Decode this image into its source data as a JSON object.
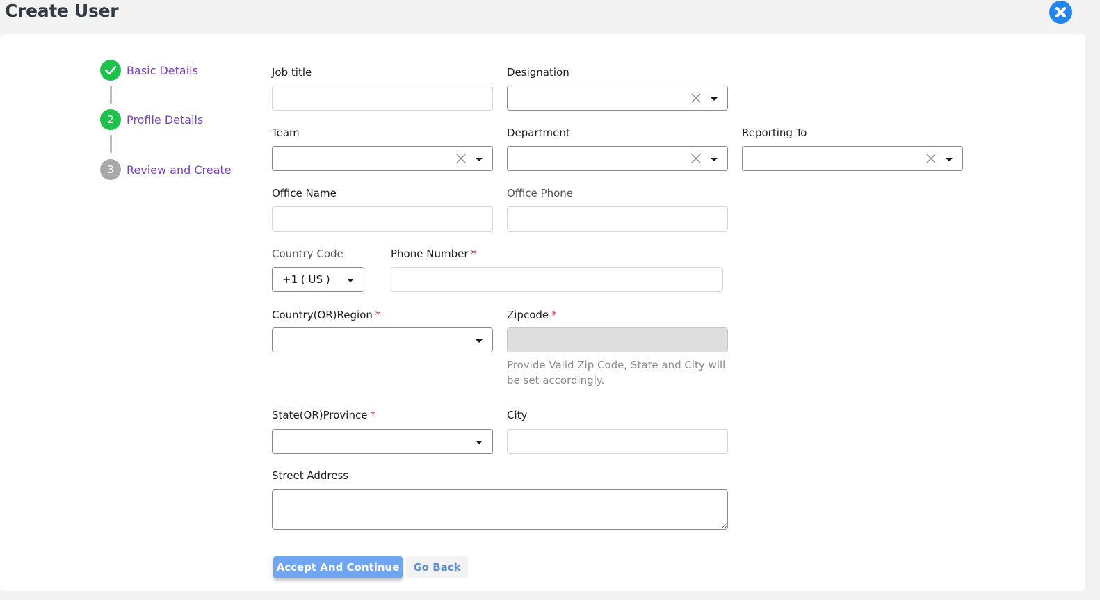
{
  "header": {
    "title": "Create User"
  },
  "stepper": {
    "steps": [
      {
        "label": "Basic Details",
        "marker": "",
        "state": "completed"
      },
      {
        "label": "Profile Details",
        "marker": "2",
        "state": "active"
      },
      {
        "label": "Review and Create",
        "marker": "3",
        "state": "pending"
      }
    ]
  },
  "form": {
    "job_title": {
      "label": "Job title",
      "value": ""
    },
    "designation": {
      "label": "Designation",
      "value": ""
    },
    "team": {
      "label": "Team",
      "value": ""
    },
    "department": {
      "label": "Department",
      "value": ""
    },
    "reporting_to": {
      "label": "Reporting To",
      "value": ""
    },
    "office_name": {
      "label": "Office Name",
      "value": ""
    },
    "office_phone": {
      "label": "Office Phone",
      "value": ""
    },
    "country_code": {
      "label": "Country Code",
      "value": "+1 ( US )"
    },
    "phone_number": {
      "label": "Phone Number",
      "required": "*",
      "value": ""
    },
    "country_region": {
      "label": "Country(OR)Region",
      "required": "*",
      "value": ""
    },
    "zipcode": {
      "label": "Zipcode",
      "required": "*",
      "value": "",
      "helper": "Provide Valid Zip Code, State and City will be set accordingly."
    },
    "state_province": {
      "label": "State(OR)Province",
      "required": "*",
      "value": ""
    },
    "city": {
      "label": "City",
      "value": ""
    },
    "street_address": {
      "label": "Street Address",
      "value": ""
    }
  },
  "actions": {
    "accept_label": "Accept And Continue",
    "back_label": "Go Back"
  },
  "colors": {
    "completed": "#1ec14b",
    "active": "#1ec14b",
    "pending": "#a9a9a9",
    "step_label": "#7b3fc2",
    "close_button": "#1f86f2",
    "primary_button": "#6fa6f2"
  },
  "icons": {
    "close": "close-circle-icon",
    "check": "check-icon",
    "clear": "clear-x-icon",
    "dropdown": "caret-down-icon"
  }
}
